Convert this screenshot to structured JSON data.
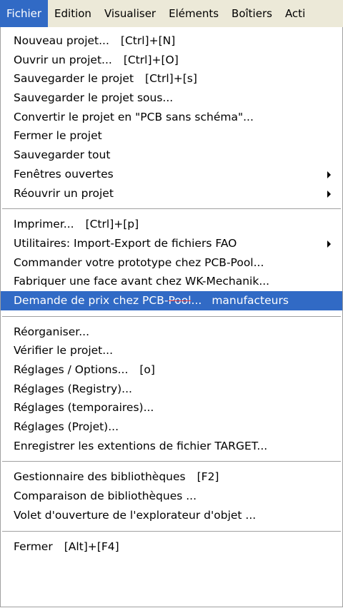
{
  "menubar": {
    "items": [
      {
        "label": "Fichier"
      },
      {
        "label": "Edition"
      },
      {
        "label": "Visualiser"
      },
      {
        "label": "Eléments"
      },
      {
        "label": "Boîtiers"
      },
      {
        "label": "Acti"
      }
    ]
  },
  "menu": {
    "group1": [
      {
        "label": "Nouveau projet...",
        "shortcut": "[Ctrl]+[N]"
      },
      {
        "label": "Ouvrir un projet...",
        "shortcut": "[Ctrl]+[O]"
      },
      {
        "label": "Sauvegarder le projet",
        "shortcut": "[Ctrl]+[s]"
      },
      {
        "label": "Sauvegarder le projet sous..."
      },
      {
        "label": "Convertir le projet en \"PCB sans schéma\"..."
      },
      {
        "label": "Fermer le projet"
      },
      {
        "label": "Sauvegarder tout"
      },
      {
        "label": "Fenêtres ouvertes",
        "submenu_icon": "triangle-right"
      },
      {
        "label": "Réouvrir un projet",
        "submenu_icon": "triangle-right"
      }
    ],
    "group2": [
      {
        "label": "Imprimer...",
        "shortcut": "[Ctrl]+[p]"
      },
      {
        "label": "Utilitaires: Import-Export de fichiers FAO",
        "submenu_icon": "triangle-right"
      },
      {
        "label": "Commander votre prototype chez PCB-Pool..."
      },
      {
        "label": "Fabriquer une face avant chez WK-Mechanik..."
      },
      {
        "label_start": "Demande de prix chez PCB-",
        "label_struck": "Pool",
        "label_end": "...",
        "extra": "manufacteurs",
        "highlighted": true,
        "highlight_color": "#316ac5",
        "strike_color": "#e03030"
      }
    ],
    "group3": [
      {
        "label": "Réorganiser..."
      },
      {
        "label": "Vérifier le projet..."
      },
      {
        "label": "Réglages / Options...",
        "shortcut": "[o]"
      },
      {
        "label": "Réglages (Registry)..."
      },
      {
        "label": "Réglages (temporaires)..."
      },
      {
        "label": "Réglages (Projet)..."
      },
      {
        "label": "Enregistrer les extentions de fichier TARGET..."
      }
    ],
    "group4": [
      {
        "label": "Gestionnaire des bibliothèques",
        "shortcut": "[F2]"
      },
      {
        "label": "Comparaison de bibliothèques ..."
      },
      {
        "label": "Volet d'ouverture de l'explorateur d'objet ..."
      }
    ],
    "group5": [
      {
        "label": "Fermer",
        "shortcut": "[Alt]+[F4]"
      }
    ]
  },
  "colors": {
    "selection": "#316ac5",
    "menubar_bg": "#ece9d8"
  }
}
